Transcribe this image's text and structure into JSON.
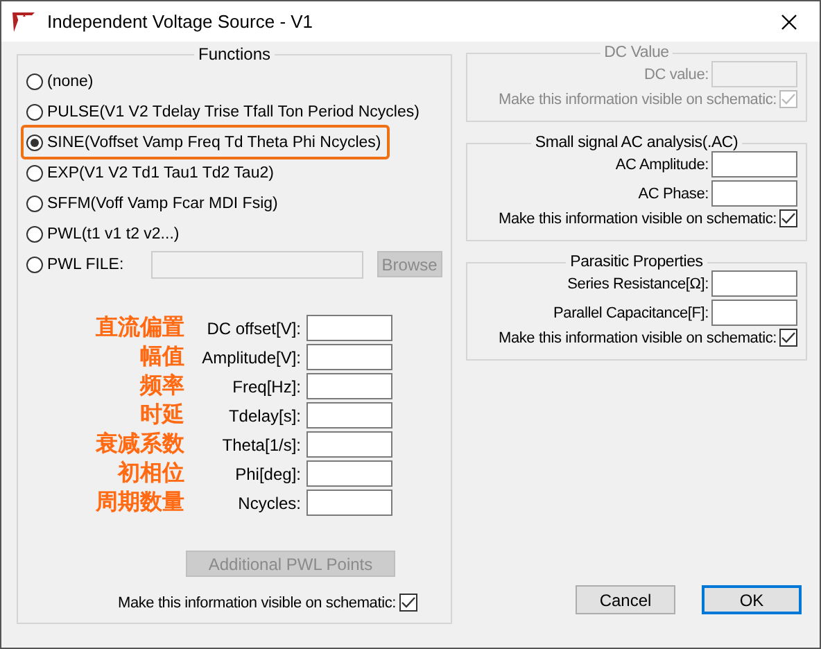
{
  "window": {
    "title": "Independent Voltage Source - V1"
  },
  "functions": {
    "title": "Functions",
    "options": [
      {
        "kind": "plain",
        "label": "(none)",
        "selected": false,
        "highlighted": false
      },
      {
        "kind": "plain",
        "label": "PULSE(V1 V2 Tdelay Trise Tfall Ton Period Ncycles)",
        "selected": false,
        "highlighted": false
      },
      {
        "kind": "plain",
        "label": "SINE(Voffset Vamp Freq Td Theta Phi Ncycles)",
        "selected": true,
        "highlighted": true
      },
      {
        "kind": "plain",
        "label": "EXP(V1 V2 Td1 Tau1 Td2 Tau2)",
        "selected": false,
        "highlighted": false
      },
      {
        "kind": "plain",
        "label": "SFFM(Voff Vamp Fcar MDI Fsig)",
        "selected": false,
        "highlighted": false
      },
      {
        "kind": "plain",
        "label": "PWL(t1 v1 t2 v2...)",
        "selected": false,
        "highlighted": false
      },
      {
        "kind": "file",
        "label": "PWL FILE:",
        "selected": false,
        "highlighted": false,
        "button": "Browse",
        "disabled": true
      }
    ],
    "parameters": [
      {
        "annotation": "直流偏置",
        "label": "DC offset[V]:"
      },
      {
        "annotation": "幅值",
        "label": "Amplitude[V]:"
      },
      {
        "annotation": "频率",
        "label": "Freq[Hz]:"
      },
      {
        "annotation": "时延",
        "label": "Tdelay[s]:"
      },
      {
        "annotation": "衰减系数",
        "label": "Theta[1/s]:"
      },
      {
        "annotation": "初相位",
        "label": "Phi[deg]:"
      },
      {
        "annotation": "周期数量",
        "label": "Ncycles:"
      }
    ],
    "additional_button": {
      "label": "Additional PWL Points",
      "disabled": true
    },
    "visible": {
      "label": "Make this information visible on schematic:",
      "checked": true
    }
  },
  "dc_value": {
    "title": "DC Value",
    "disabled": true,
    "fields": [
      {
        "label": "DC value:"
      }
    ],
    "visible": {
      "label": "Make this information visible on schematic:",
      "checked": true
    }
  },
  "ac_analysis": {
    "title": "Small signal AC analysis(.AC)",
    "disabled": false,
    "fields": [
      {
        "label": "AC Amplitude:"
      },
      {
        "label": "AC Phase:"
      }
    ],
    "visible": {
      "label": "Make this information visible on schematic:",
      "checked": true
    }
  },
  "parasitic": {
    "title": "Parasitic Properties",
    "disabled": false,
    "fields": [
      {
        "label": "Series Resistance[Ω]:"
      },
      {
        "label": "Parallel Capacitance[F]:"
      }
    ],
    "visible": {
      "label": "Make this information visible on schematic:",
      "checked": true
    }
  },
  "buttons": [
    {
      "label": "Cancel",
      "default": false
    },
    {
      "label": "OK",
      "default": true
    }
  ]
}
